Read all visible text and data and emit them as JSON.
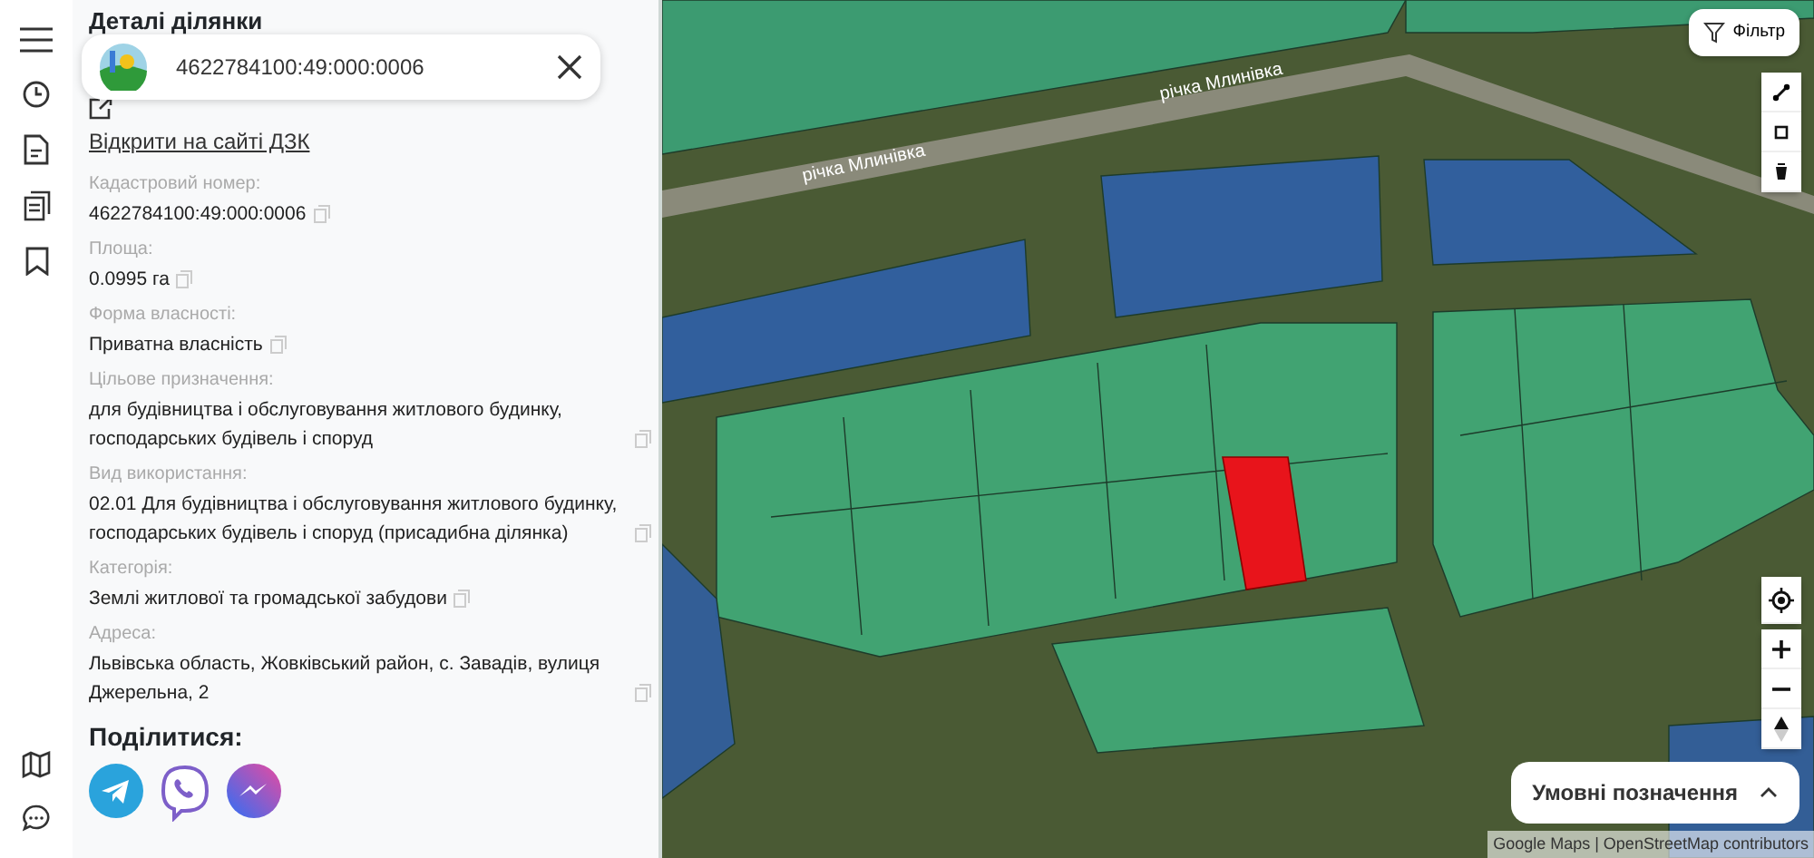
{
  "panel": {
    "heading": "Деталі ділянки",
    "search": {
      "value": "4622784100:49:000:0006"
    },
    "external_link": "Відкрити на сайті ДЗК",
    "fields": [
      {
        "label": "Кадастровий номер:",
        "value": "4622784100:49:000:0006"
      },
      {
        "label": "Площа:",
        "value": "0.0995 га"
      },
      {
        "label": "Форма власності:",
        "value": "Приватна власність"
      },
      {
        "label": "Цільове призначення:",
        "value": "для будівництва і обслуговування житлового будинку, господарських будівель і споруд"
      },
      {
        "label": "Вид використання:",
        "value": "02.01 Для будівництва і обслуговування житлового будинку, господарських будівель і споруд (присадибна ділянка)"
      },
      {
        "label": "Категорія:",
        "value": "Землі житлової та громадської забудови"
      },
      {
        "label": "Адреса:",
        "value": "Львівська область, Жовківський район, с. Завадів, вулиця Джерельна, 2"
      }
    ],
    "share_title": "Поділитися:"
  },
  "map": {
    "labels": [
      "річка Млинівка",
      "річка Млинівка"
    ],
    "filter_button": "Фільтр",
    "legend_button": "Умовні позначення",
    "attribution": "Google Maps | OpenStreetMap contributors"
  }
}
